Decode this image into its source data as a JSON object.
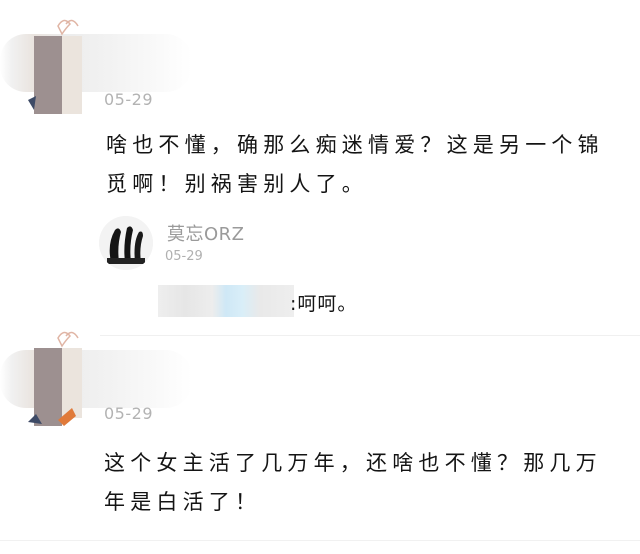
{
  "comments": [
    {
      "date": "05-29",
      "text": "啥也不懂，确那么痴迷情爱？这是另一个锦觅啊！别祸害别人了。",
      "reply": {
        "username": "莫忘ORZ",
        "date": "05-29",
        "text": ":呵呵。"
      }
    },
    {
      "date": "05-29",
      "text": "这个女主活了几万年，还啥也不懂？那几万年是白活了！"
    }
  ],
  "colors": {
    "text": "#141414",
    "meta": "#b3b3b3",
    "username": "#9a9a9a"
  }
}
